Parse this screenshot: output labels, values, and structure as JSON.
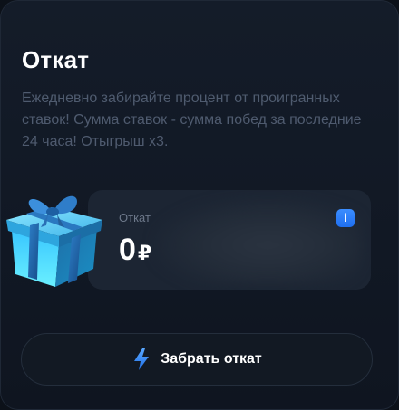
{
  "title": "Откат",
  "description": "Ежедневно забирайте процент от проигранных ставок! Сумма ставок - сумма побед за последние 24 часа! Отыгрыш x3.",
  "rakeback": {
    "label": "Откат",
    "amount": "0",
    "currency": "₽",
    "info_icon": "info-icon",
    "info_symbol": "i"
  },
  "gift_icon": "gift-box-icon",
  "claim_button": {
    "label": "Забрать откат",
    "icon": "lightning-bolt-icon"
  },
  "colors": {
    "background": "#111824",
    "accent": "#2f84ff",
    "gift": "#4fd3ff",
    "text_muted": "#4f5b6f"
  }
}
